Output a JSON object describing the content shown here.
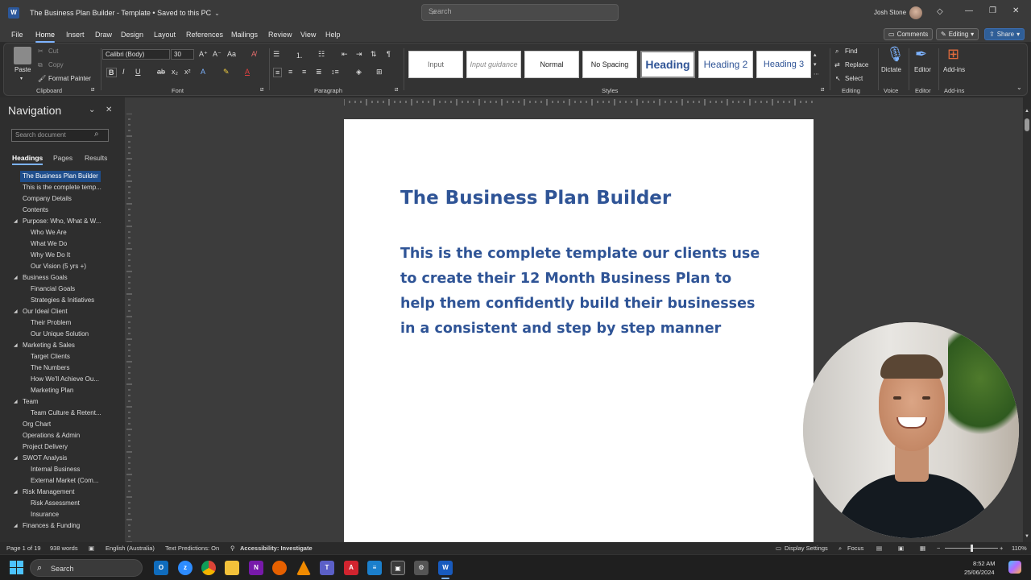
{
  "titlebar": {
    "doc_title": "The Business Plan Builder - Template • Saved to this PC",
    "search_placeholder": "Search",
    "user_name": "Josh Stone"
  },
  "menu": {
    "tabs": [
      "File",
      "Home",
      "Insert",
      "Draw",
      "Design",
      "Layout",
      "References",
      "Mailings",
      "Review",
      "View",
      "Help"
    ],
    "active_tab": "Home",
    "comments_label": "Comments",
    "editing_label": "Editing",
    "share_label": "Share"
  },
  "ribbon": {
    "clipboard": {
      "paste": "Paste",
      "cut": "Cut",
      "copy": "Copy",
      "format_painter": "Format Painter",
      "group_label": "Clipboard"
    },
    "font": {
      "font_name": "Calibri (Body)",
      "font_size": "30",
      "group_label": "Font"
    },
    "paragraph": {
      "group_label": "Paragraph"
    },
    "styles": {
      "items": [
        "Input",
        "Input guidance",
        "Normal",
        "No Spacing",
        "Heading",
        "Heading 2",
        "Heading 3"
      ],
      "group_label": "Styles"
    },
    "editing": {
      "find": "Find",
      "replace": "Replace",
      "select": "Select",
      "group_label": "Editing"
    },
    "voice": {
      "dictate": "Dictate",
      "group_label": "Voice"
    },
    "editor": {
      "editor": "Editor",
      "group_label": "Editor"
    },
    "addins": {
      "addins": "Add-ins",
      "group_label": "Add-ins"
    }
  },
  "navigation": {
    "title": "Navigation",
    "search_placeholder": "Search document",
    "tabs": [
      "Headings",
      "Pages",
      "Results"
    ],
    "items": [
      {
        "label": "The Business Plan Builder",
        "level": 1,
        "expand": false,
        "selected": true
      },
      {
        "label": "This is the complete temp...",
        "level": 1,
        "expand": false
      },
      {
        "label": "Company Details",
        "level": 1,
        "expand": false
      },
      {
        "label": "Contents",
        "level": 1,
        "expand": false
      },
      {
        "label": "Purpose: Who, What & W...",
        "level": 1,
        "expand": true
      },
      {
        "label": "Who We Are",
        "level": 2
      },
      {
        "label": "What We Do",
        "level": 2
      },
      {
        "label": "Why We Do It",
        "level": 2
      },
      {
        "label": "Our Vision (5 yrs +)",
        "level": 2
      },
      {
        "label": "Business Goals",
        "level": 1,
        "expand": true
      },
      {
        "label": "Financial Goals",
        "level": 2
      },
      {
        "label": "Strategies & Initiatives",
        "level": 2
      },
      {
        "label": "Our Ideal Client",
        "level": 1,
        "expand": true
      },
      {
        "label": "Their Problem",
        "level": 2
      },
      {
        "label": "Our Unique Solution",
        "level": 2
      },
      {
        "label": "Marketing & Sales",
        "level": 1,
        "expand": true
      },
      {
        "label": "Target Clients",
        "level": 2
      },
      {
        "label": "The Numbers",
        "level": 2
      },
      {
        "label": "How We'll Achieve Ou...",
        "level": 2
      },
      {
        "label": "Marketing Plan",
        "level": 2
      },
      {
        "label": "Team",
        "level": 1,
        "expand": true
      },
      {
        "label": "Team Culture & Retent...",
        "level": 2
      },
      {
        "label": "Org Chart",
        "level": 1,
        "expand": false
      },
      {
        "label": "Operations & Admin",
        "level": 1,
        "expand": false
      },
      {
        "label": "Project Delivery",
        "level": 1,
        "expand": false
      },
      {
        "label": "SWOT Analysis",
        "level": 1,
        "expand": true
      },
      {
        "label": "Internal Business",
        "level": 2
      },
      {
        "label": "External Market (Com...",
        "level": 2
      },
      {
        "label": "Risk Management",
        "level": 1,
        "expand": true
      },
      {
        "label": "Risk Assessment",
        "level": 2
      },
      {
        "label": "Insurance",
        "level": 2
      },
      {
        "label": "Finances & Funding",
        "level": 1,
        "expand": true
      }
    ]
  },
  "document": {
    "heading": "The Business Plan Builder",
    "subheading": "This is the complete template our clients use to create their 12 Month Business Plan to help them confidently build their businesses in a consistent and step by step manner"
  },
  "statusbar": {
    "page": "Page 1 of 19",
    "words": "938 words",
    "language": "English (Australia)",
    "text_predictions": "Text Predictions: On",
    "accessibility": "Accessibility: Investigate",
    "display_settings": "Display Settings",
    "focus": "Focus",
    "zoom": "110%"
  },
  "taskbar": {
    "search_label": "Search",
    "time": "8:52 AM",
    "date": "25/06/2024"
  },
  "colors": {
    "accent": "#2f5496",
    "ribbon_bg": "#333333",
    "selection": "#1f4e8c"
  }
}
